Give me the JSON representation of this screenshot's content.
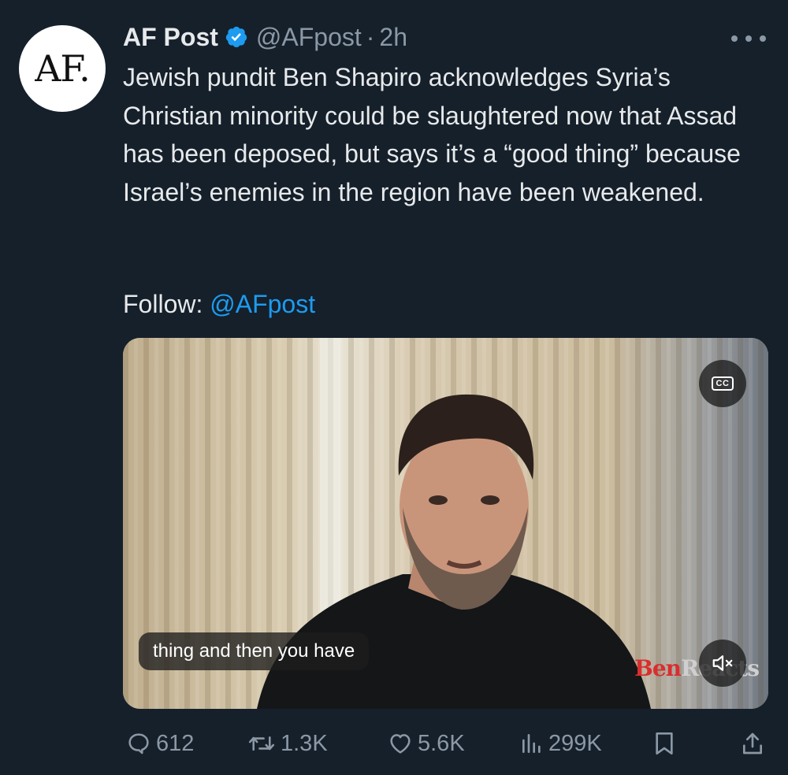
{
  "author": {
    "avatar_text": "AF.",
    "display_name": "AF Post",
    "handle": "@AFpost",
    "separator": "·",
    "time": "2h",
    "verified": true
  },
  "tweet": {
    "text": "Jewish pundit Ben Shapiro acknowledges Syria’s Christian minority could be slaughtered now that Assad has been deposed, but says it’s a “good thing” because Israel’s enemies in the region have been weakened.",
    "follow_label": "Follow:",
    "follow_link": "@AFpost"
  },
  "media": {
    "caption": "thing and then you have",
    "cc_label": "CC",
    "watermark_a": "Ben",
    "watermark_b": "Reacts"
  },
  "actions": {
    "replies": "612",
    "retweets": "1.3K",
    "likes": "5.6K",
    "views": "299K"
  },
  "icons": [
    "verified-icon",
    "more-icon",
    "cc-icon",
    "mute-icon",
    "reply-icon",
    "retweet-icon",
    "like-icon",
    "views-icon",
    "bookmark-icon",
    "share-icon"
  ],
  "colors": {
    "background": "#15202b",
    "text": "#e7e9ea",
    "secondary": "#8b98a5",
    "accent": "#1d9bf0"
  }
}
